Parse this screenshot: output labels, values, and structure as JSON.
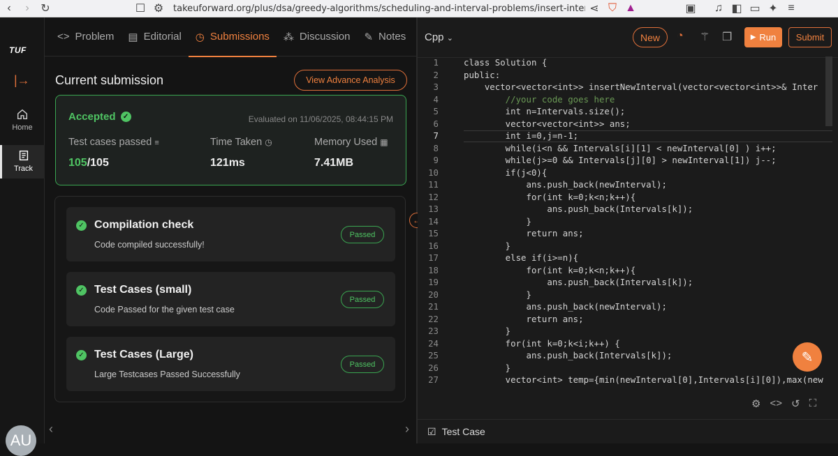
{
  "browser": {
    "url": "takeuforward.org/plus/dsa/greedy-algorithms/scheduling-and-interval-problems/insert-interval?t...",
    "ext_badge": "6"
  },
  "rail": {
    "logo": "TUF",
    "home_label": "Home",
    "track_label": "Track",
    "avatar_initials": "AU"
  },
  "tabs": [
    {
      "label": "Problem",
      "icon": "code-brackets-icon"
    },
    {
      "label": "Editorial",
      "icon": "document-icon"
    },
    {
      "label": "Submissions",
      "icon": "clock-icon"
    },
    {
      "label": "Discussion",
      "icon": "people-icon"
    },
    {
      "label": "Notes",
      "icon": "note-icon"
    }
  ],
  "submission": {
    "title": "Current submission",
    "advance_btn": "View Advance Analysis",
    "status": "Accepted",
    "evaluated": "Evaluated on 11/06/2025, 08:44:15 PM",
    "tests_label": "Test cases passed",
    "tests_passed": "105",
    "tests_total": "/105",
    "time_label": "Time Taken",
    "time_value": "121ms",
    "memory_label": "Memory Used",
    "memory_value": "7.41MB"
  },
  "checks": [
    {
      "title": "Compilation check",
      "desc": "Code compiled successfully!",
      "badge": "Passed"
    },
    {
      "title": "Test Cases (small)",
      "desc": "Code Passed for the given test case",
      "badge": "Passed"
    },
    {
      "title": "Test Cases (Large)",
      "desc": "Large Testcases Passed Successfully",
      "badge": "Passed"
    }
  ],
  "editor": {
    "language": "Cpp",
    "new_btn": "New",
    "run_btn": "Run",
    "submit_btn": "Submit",
    "test_case_label": "Test Case",
    "active_line": 7,
    "lines": [
      "class Solution {",
      "public:",
      "    vector<vector<int>> insertNewInterval(vector<vector<int>>& Inter",
      "        //your code goes here",
      "        int n=Intervals.size();",
      "        vector<vector<int>> ans;",
      "        int i=0,j=n-1;",
      "        while(i<n && Intervals[i][1] < newInterval[0] ) i++;",
      "        while(j>=0 && Intervals[j][0] > newInterval[1]) j--;",
      "        if(j<0){",
      "            ans.push_back(newInterval);",
      "            for(int k=0;k<n;k++){",
      "                ans.push_back(Intervals[k]);",
      "            }",
      "            return ans;",
      "        }",
      "        else if(i>=n){",
      "            for(int k=0;k<n;k++){",
      "                ans.push_back(Intervals[k]);",
      "            }",
      "            ans.push_back(newInterval);",
      "            return ans;",
      "        }",
      "        for(int k=0;k<i;k++) {",
      "            ans.push_back(Intervals[k]);",
      "        }",
      "        vector<int> temp={min(newInterval[0],Intervals[i][0]),max(new"
    ]
  },
  "colors": {
    "accent": "#f0813f",
    "success": "#4fc463"
  }
}
